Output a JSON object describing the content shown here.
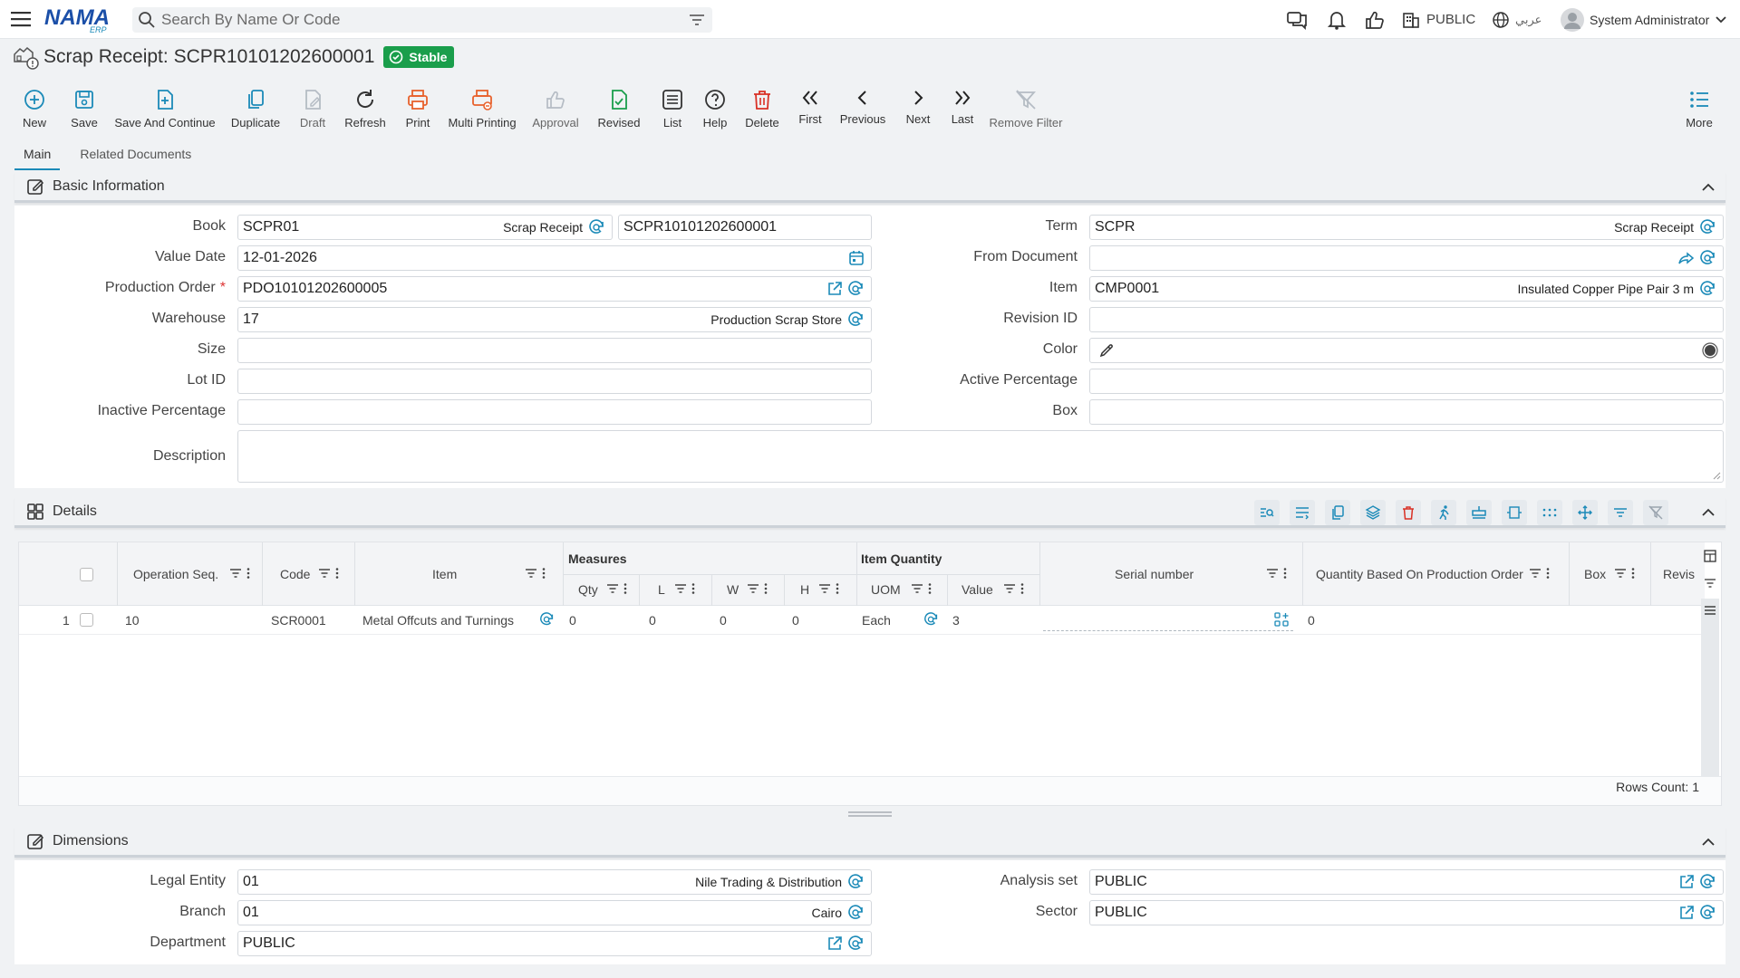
{
  "app": {
    "logo_text": "NAMA",
    "logo_sub": "ERP",
    "search_placeholder": "Search By Name Or Code",
    "analysis_set": "PUBLIC",
    "language": "عربي",
    "user": "System Administrator"
  },
  "page": {
    "title": "Scrap Receipt: SCPR10101202600001",
    "status": "Stable"
  },
  "toolbar": {
    "new": "New",
    "save": "Save",
    "save_continue": "Save And Continue",
    "duplicate": "Duplicate",
    "draft": "Draft",
    "refresh": "Refresh",
    "print": "Print",
    "multi_printing": "Multi Printing",
    "approval": "Approval",
    "revised": "Revised",
    "list": "List",
    "help": "Help",
    "delete": "Delete",
    "first": "First",
    "previous": "Previous",
    "next": "Next",
    "last": "Last",
    "remove_filter": "Remove Filter",
    "more": "More"
  },
  "tabs": [
    "Main",
    "Related Documents"
  ],
  "basic": {
    "title": "Basic Information",
    "book_label": "Book",
    "book_code": "SCPR01",
    "book_desc": "Scrap Receipt",
    "book_number": "SCPR10101202600001",
    "value_date_label": "Value Date",
    "value_date": "12-01-2026",
    "production_order_label": "Production Order",
    "production_order": "PDO10101202600005",
    "warehouse_label": "Warehouse",
    "warehouse_code": "17",
    "warehouse_desc": "Production Scrap Store",
    "size_label": "Size",
    "lot_label": "Lot ID",
    "inactive_label": "Inactive Percentage",
    "description_label": "Description",
    "term_label": "Term",
    "term_code": "SCPR",
    "term_desc": "Scrap Receipt",
    "from_document_label": "From Document",
    "item_label": "Item",
    "item_code": "CMP0001",
    "item_desc": "Insulated Copper Pipe Pair 3 m",
    "revision_label": "Revision ID",
    "color_label": "Color",
    "active_label": "Active Percentage",
    "box_label": "Box"
  },
  "details": {
    "title": "Details",
    "columns": {
      "operation_seq": "Operation Seq.",
      "code": "Code",
      "item": "Item",
      "measures": "Measures",
      "qty": "Qty",
      "l": "L",
      "w": "W",
      "h": "H",
      "item_quantity": "Item Quantity",
      "uom": "UOM",
      "value": "Value",
      "serial": "Serial number",
      "qty_based": "Quantity Based On Production Order",
      "box": "Box",
      "revision": "Revis"
    },
    "rows": [
      {
        "num": "1",
        "operation_seq": "10",
        "code": "SCR0001",
        "item": "Metal Offcuts and Turnings",
        "qty": "0",
        "l": "0",
        "w": "0",
        "h": "0",
        "uom": "Each",
        "value": "3",
        "qty_based": "0"
      }
    ],
    "rows_count": "Rows Count: 1"
  },
  "dimensions": {
    "title": "Dimensions",
    "legal_entity_label": "Legal Entity",
    "legal_entity_code": "01",
    "legal_entity_desc": "Nile Trading & Distribution",
    "branch_label": "Branch",
    "branch_code": "01",
    "branch_desc": "Cairo",
    "department_label": "Department",
    "department": "PUBLIC",
    "analysis_set_label": "Analysis set",
    "analysis_set": "PUBLIC",
    "sector_label": "Sector",
    "sector": "PUBLIC"
  },
  "colors": {
    "accent": "#1b8ab8",
    "status_green": "#1a9e4b",
    "danger": "#d93025",
    "orange": "#e8612c"
  }
}
